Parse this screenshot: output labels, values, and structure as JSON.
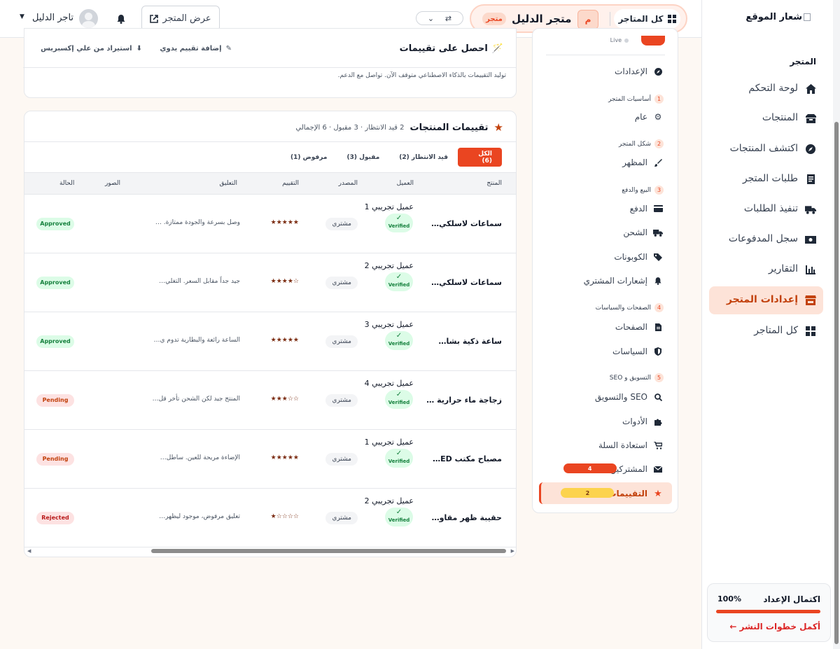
{
  "topbar": {
    "all_stores": "كل المتاجر",
    "store_initial": "م",
    "store_name": "متجر الدليل",
    "store_badge": "متجر",
    "view_store": "عرض المتجر",
    "user_name": "تاجر الدليل"
  },
  "sidebar": {
    "logo": "شعار الموقع",
    "section": "المتجر",
    "items": [
      {
        "label": "لوحة التحكم",
        "icon": "home-icon"
      },
      {
        "label": "المنتجات",
        "icon": "box-icon"
      },
      {
        "label": "اكتشف المنتجات",
        "icon": "compass-icon"
      },
      {
        "label": "طلبات المتجر",
        "icon": "receipt-icon"
      },
      {
        "label": "تنفيذ الطلبات",
        "icon": "truck-icon"
      },
      {
        "label": "سجل المدفوعات",
        "icon": "money-icon"
      },
      {
        "label": "التقارير",
        "icon": "chart-icon"
      },
      {
        "label": "إعدادات المتجر",
        "icon": "store-icon",
        "active": true
      },
      {
        "label": "كل المتاجر",
        "icon": "grid-icon"
      }
    ],
    "setup": {
      "title": "اكتمال الإعداد",
      "percent": "100%",
      "progress": 1.0,
      "link": "أكمل خطوات النشر ←"
    }
  },
  "settings": {
    "live": "Live",
    "settings_label": "الإعدادات",
    "groups": [
      {
        "num": "1",
        "label": "أساسيات المتجر"
      },
      {
        "num": "2",
        "label": "شكل المتجر"
      },
      {
        "num": "3",
        "label": "البيع والدفع"
      },
      {
        "num": "4",
        "label": "الصفحات والسياسات"
      },
      {
        "num": "5",
        "label": "التسويق و SEO"
      }
    ],
    "items": {
      "general": "عام",
      "appearance": "المظهر",
      "payment": "الدفع",
      "shipping": "الشحن",
      "coupons": "الكوبونات",
      "buyer_notifications": "إشعارات المشتري",
      "pages": "الصفحات",
      "policies": "السياسات",
      "seo": "SEO والتسويق",
      "tools": "الأدوات",
      "cart_recovery": "استعادة السلة",
      "subscribers": "المشتركين",
      "subscribers_count": "4",
      "reviews": "التقييمات",
      "reviews_count": "2"
    }
  },
  "get_reviews": {
    "title": "احصل على تقييمات",
    "manual": "إضافة تقييم يدوي",
    "import": "استيراد من علي إكسبريس",
    "note": "توليد التقييمات بالذكاء الاصطناعي متوقف الآن. تواصل مع الدعم."
  },
  "reviews": {
    "title": "تقييمات المنتجات",
    "summary": "2 قيد الانتظار · 3 مقبول · 6 الإجمالي",
    "tabs": [
      "الكل (6)",
      "قيد الانتظار (2)",
      "مقبول (3)",
      "مرفوض (1)"
    ],
    "columns": [
      "المنتج",
      "العميل",
      "المصدر",
      "التقييم",
      "التعليق",
      "الصور",
      "الحالة"
    ],
    "verified_label": "Verified",
    "rows": [
      {
        "product": "سماعات لاسلكي…",
        "customer": "عميل تجريبي 1",
        "source": "مشتري",
        "stars": "★★★★★",
        "comment": "وصل بسرعة والجودة ممتازة. …",
        "status": "Approved",
        "status_kind": "approved"
      },
      {
        "product": "سماعات لاسلكي…",
        "customer": "عميل تجريبي 2",
        "source": "مشتري",
        "stars": "☆★★★★",
        "comment": "جيد جداً مقابل السعر. التغلي…",
        "status": "Approved",
        "status_kind": "approved"
      },
      {
        "product": "ساعة ذكية بشا…",
        "customer": "عميل تجريبي 3",
        "source": "مشتري",
        "stars": "★★★★★",
        "comment": "الساعة رائعة والبطارية تدوم ي…",
        "status": "Approved",
        "status_kind": "approved"
      },
      {
        "product": "زجاجة ماء حرارية …",
        "customer": "عميل تجريبي 4",
        "source": "مشتري",
        "stars": "☆☆★★★",
        "comment": "المنتج جيد لكن الشحن تأخر قل…",
        "status": "Pending",
        "status_kind": "pending"
      },
      {
        "product": "مصباح مكتب ED…",
        "customer": "عميل تجريبي 1",
        "source": "مشتري",
        "stars": "★★★★★",
        "comment": "الإضاءة مريحة للعين. ساطل…",
        "status": "Pending",
        "status_kind": "pending"
      },
      {
        "product": "حقيبة ظهر مقاو…",
        "customer": "عميل تجريبي 2",
        "source": "مشتري",
        "stars": "☆☆☆☆★",
        "comment": "تعليق مرفوض، موجود ليظهر…",
        "status": "Rejected",
        "status_kind": "rejected"
      }
    ]
  },
  "colors": {
    "accent": "#ea4521",
    "accent_soft": "#fde3d8",
    "approved": "#15803d",
    "pending": "#c2410c"
  }
}
